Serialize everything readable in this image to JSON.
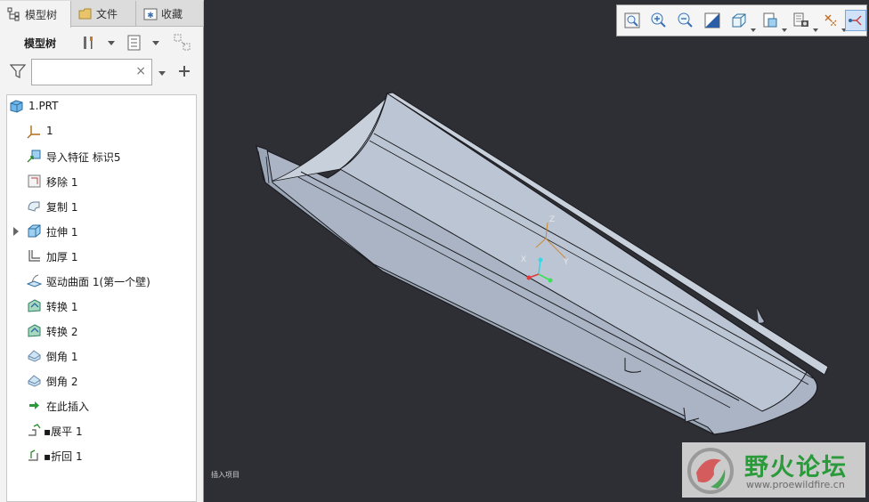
{
  "tabs": [
    {
      "label": "模型树",
      "icon": "model-tree-icon"
    },
    {
      "label": "文件",
      "icon": "folder-icon"
    },
    {
      "label": "收藏",
      "icon": "favorites-icon"
    }
  ],
  "toolrow": {
    "title": "模型树"
  },
  "filter": {
    "value": "",
    "placeholder": "",
    "clear": "×"
  },
  "tree": [
    {
      "label": "1.PRT",
      "icon": "part-icon"
    },
    {
      "label": "1",
      "icon": "coordinate-system-icon"
    },
    {
      "label": "导入特征 标识5",
      "icon": "import-feature-icon"
    },
    {
      "label": "移除 1",
      "icon": "remove-icon"
    },
    {
      "label": "复制 1",
      "icon": "copy-icon"
    },
    {
      "label": "拉伸 1",
      "icon": "extrude-icon",
      "expandable": true
    },
    {
      "label": "加厚 1",
      "icon": "thicken-icon"
    },
    {
      "label": "驱动曲面 1(第一个壁)",
      "icon": "driving-surface-icon"
    },
    {
      "label": "转换 1",
      "icon": "conversion-icon"
    },
    {
      "label": "转换 2",
      "icon": "conversion-icon"
    },
    {
      "label": "倒角 1",
      "icon": "chamfer-icon"
    },
    {
      "label": "倒角 2",
      "icon": "chamfer-icon"
    },
    {
      "label": "在此插入",
      "icon": "insert-here-icon"
    },
    {
      "label": "展平 1",
      "icon": "unbend-icon"
    },
    {
      "label": "折回 1",
      "icon": "bend-back-icon"
    }
  ],
  "axes": {
    "z": "Z",
    "x": "X",
    "y": "Y"
  },
  "status_text": "插入项目",
  "watermark": {
    "title": "野火论坛",
    "url": "www.proewildfire.cn"
  },
  "colors": {
    "model": "#b7c0cf",
    "background": "#2e2e35",
    "watermark_green": "#2a9a3a"
  }
}
